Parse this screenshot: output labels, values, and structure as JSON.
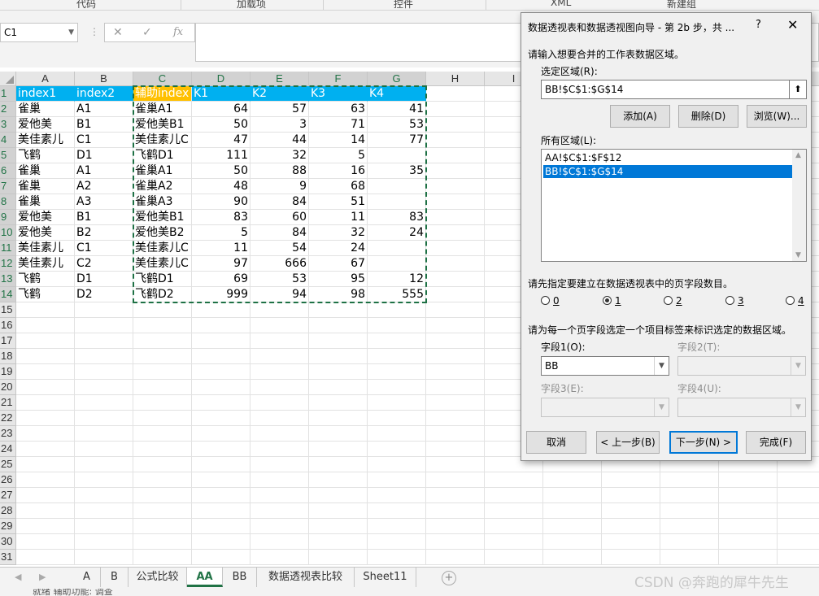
{
  "ribbon_groups": [
    "代码",
    "加载项",
    "控件",
    "XML",
    "新建组"
  ],
  "name_box": "C1",
  "formula": {
    "fx": "fx",
    "value": ""
  },
  "columns": [
    "A",
    "B",
    "C",
    "D",
    "E",
    "F",
    "G",
    "H",
    "I"
  ],
  "rows": [
    "1",
    "2",
    "3",
    "4",
    "5",
    "6",
    "7",
    "8",
    "9",
    "10",
    "11",
    "12",
    "13",
    "14",
    "15",
    "16",
    "17",
    "18",
    "19",
    "20",
    "21",
    "22",
    "23",
    "24",
    "25",
    "26",
    "27",
    "28",
    "29",
    "30",
    "31"
  ],
  "table": {
    "header": [
      "index1",
      "index2",
      "辅助index",
      "K1",
      "K2",
      "K3",
      "K4"
    ],
    "data": [
      [
        "雀巢",
        "A1",
        "雀巢A1",
        "64",
        "57",
        "63",
        "41"
      ],
      [
        "爱他美",
        "B1",
        "爱他美B1",
        "50",
        "3",
        "71",
        "53"
      ],
      [
        "美佳素儿",
        "C1",
        "美佳素儿C",
        "47",
        "44",
        "14",
        "77"
      ],
      [
        "飞鹤",
        "D1",
        "飞鹤D1",
        "111",
        "32",
        "5",
        ""
      ],
      [
        "雀巢",
        "A1",
        "雀巢A1",
        "50",
        "88",
        "16",
        "35"
      ],
      [
        "雀巢",
        "A2",
        "雀巢A2",
        "48",
        "9",
        "68",
        ""
      ],
      [
        "雀巢",
        "A3",
        "雀巢A3",
        "90",
        "84",
        "51",
        ""
      ],
      [
        "爱他美",
        "B1",
        "爱他美B1",
        "83",
        "60",
        "11",
        "83"
      ],
      [
        "爱他美",
        "B2",
        "爱他美B2",
        "5",
        "84",
        "32",
        "24"
      ],
      [
        "美佳素儿",
        "C1",
        "美佳素儿C",
        "11",
        "54",
        "24",
        ""
      ],
      [
        "美佳素儿",
        "C2",
        "美佳素儿C",
        "97",
        "666",
        "67",
        ""
      ],
      [
        "飞鹤",
        "D1",
        "飞鹤D1",
        "69",
        "53",
        "95",
        "12"
      ],
      [
        "飞鹤",
        "D2",
        "飞鹤D2",
        "999",
        "94",
        "98",
        "555"
      ]
    ]
  },
  "sheet_tabs": [
    "A",
    "B",
    "公式比较",
    "AA",
    "BB",
    "数据透视表比较",
    "Sheet11"
  ],
  "active_tab": "AA",
  "watermark": "CSDN @奔跑的犀牛先生",
  "status_text": "就绪 辅助功能: 调查",
  "dialog": {
    "title": "数据透视表和数据透视图向导 - 第 2b 步，共 ...",
    "help": "?",
    "close": "✕",
    "instruction": "请输入想要合并的工作表数据区域。",
    "range_label": "选定区域(R):",
    "range_value": "BB!$C$1:$G$14",
    "add_button": "添加(A)",
    "delete_button": "删除(D)",
    "browse_button": "浏览(W)...",
    "all_ranges_label": "所有区域(L):",
    "all_ranges": [
      "AA!$C$1:$F$12",
      "BB!$C$1:$G$14"
    ],
    "selected_range_index": 1,
    "page_field_prompt": "请先指定要建立在数据透视表中的页字段数目。",
    "page_counts": [
      "0",
      "1",
      "2",
      "3",
      "4"
    ],
    "selected_page_count": "1",
    "label_prompt": "请为每一个页字段选定一个项目标签来标识选定的数据区域。",
    "field1_label": "字段1(O):",
    "field1_value": "BB",
    "field2_label": "字段2(T):",
    "field3_label": "字段3(E):",
    "field4_label": "字段4(U):",
    "cancel_button": "取消",
    "back_button": "< 上一步(B)",
    "next_button": "下一步(N) >",
    "finish_button": "完成(F)"
  }
}
